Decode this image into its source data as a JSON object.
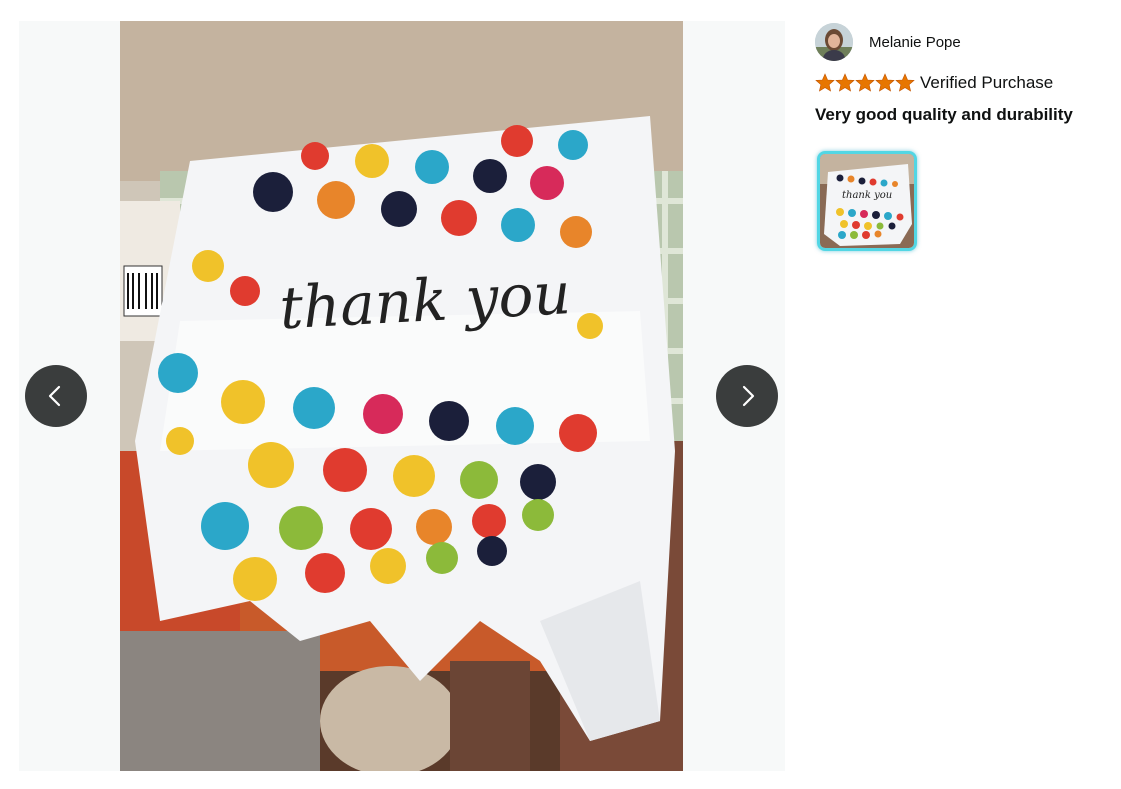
{
  "gallery": {
    "photo_caption": "thank you",
    "prev_label": "Previous image",
    "next_label": "Next image"
  },
  "review": {
    "reviewer_name": "Melanie Pope",
    "rating": 5,
    "rating_max": 5,
    "verified_label": "Verified Purchase",
    "title": "Very good quality and durability"
  },
  "thumbnails": [
    {
      "caption": "thank you",
      "selected": true
    }
  ],
  "colors": {
    "star": "#e77600",
    "nav_button": "#3a3d3d",
    "thumb_border": "#52d6e4",
    "dots": [
      "#1b1f3a",
      "#e8852a",
      "#f0c22a",
      "#2ba7c9",
      "#e03b2f",
      "#d72a5a",
      "#8cba3a"
    ]
  }
}
